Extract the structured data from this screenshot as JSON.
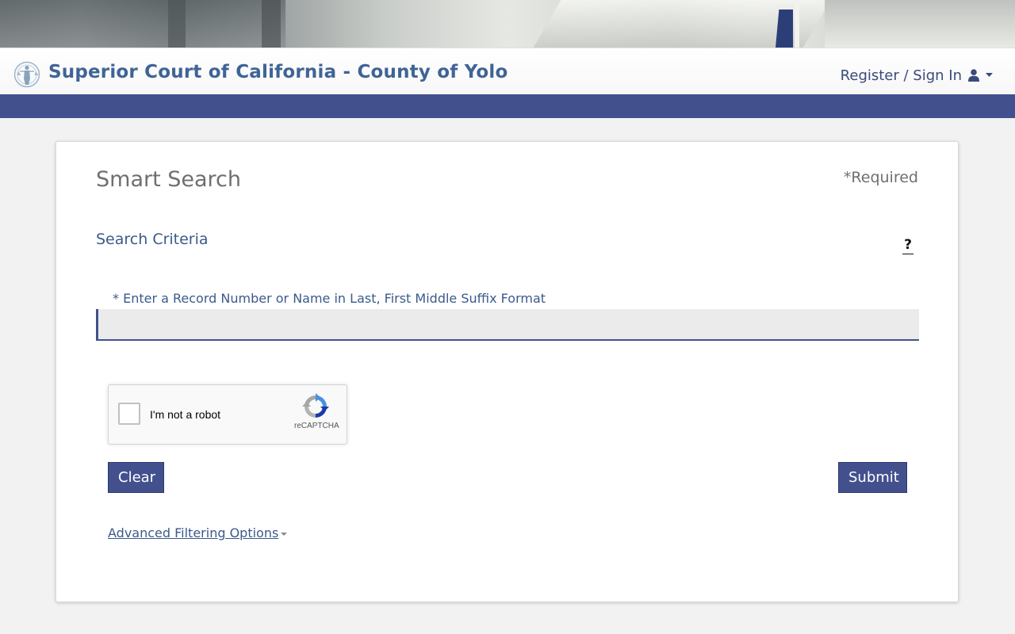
{
  "header": {
    "title": "Superior Court of California - County of Yolo",
    "signin_label": "Register / Sign In",
    "logo_icon": "court-seal-icon",
    "user_icon": "user-icon",
    "caret_icon": "caret-down-icon"
  },
  "colors": {
    "brand": "#43508e",
    "title_text": "#3f6496",
    "link_text": "#3b5a8a"
  },
  "main": {
    "page_title": "Smart Search",
    "required_note": "*Required",
    "section_title": "Search Criteria",
    "help_icon": "?",
    "field_label": "* Enter a Record Number or Name in Last, First Middle Suffix Format",
    "search_value": "",
    "recaptcha": {
      "label": "I'm not a robot",
      "brand": "reCAPTCHA"
    },
    "clear_label": "Clear",
    "submit_label": "Submit",
    "advanced_label": "Advanced Filtering Options"
  }
}
